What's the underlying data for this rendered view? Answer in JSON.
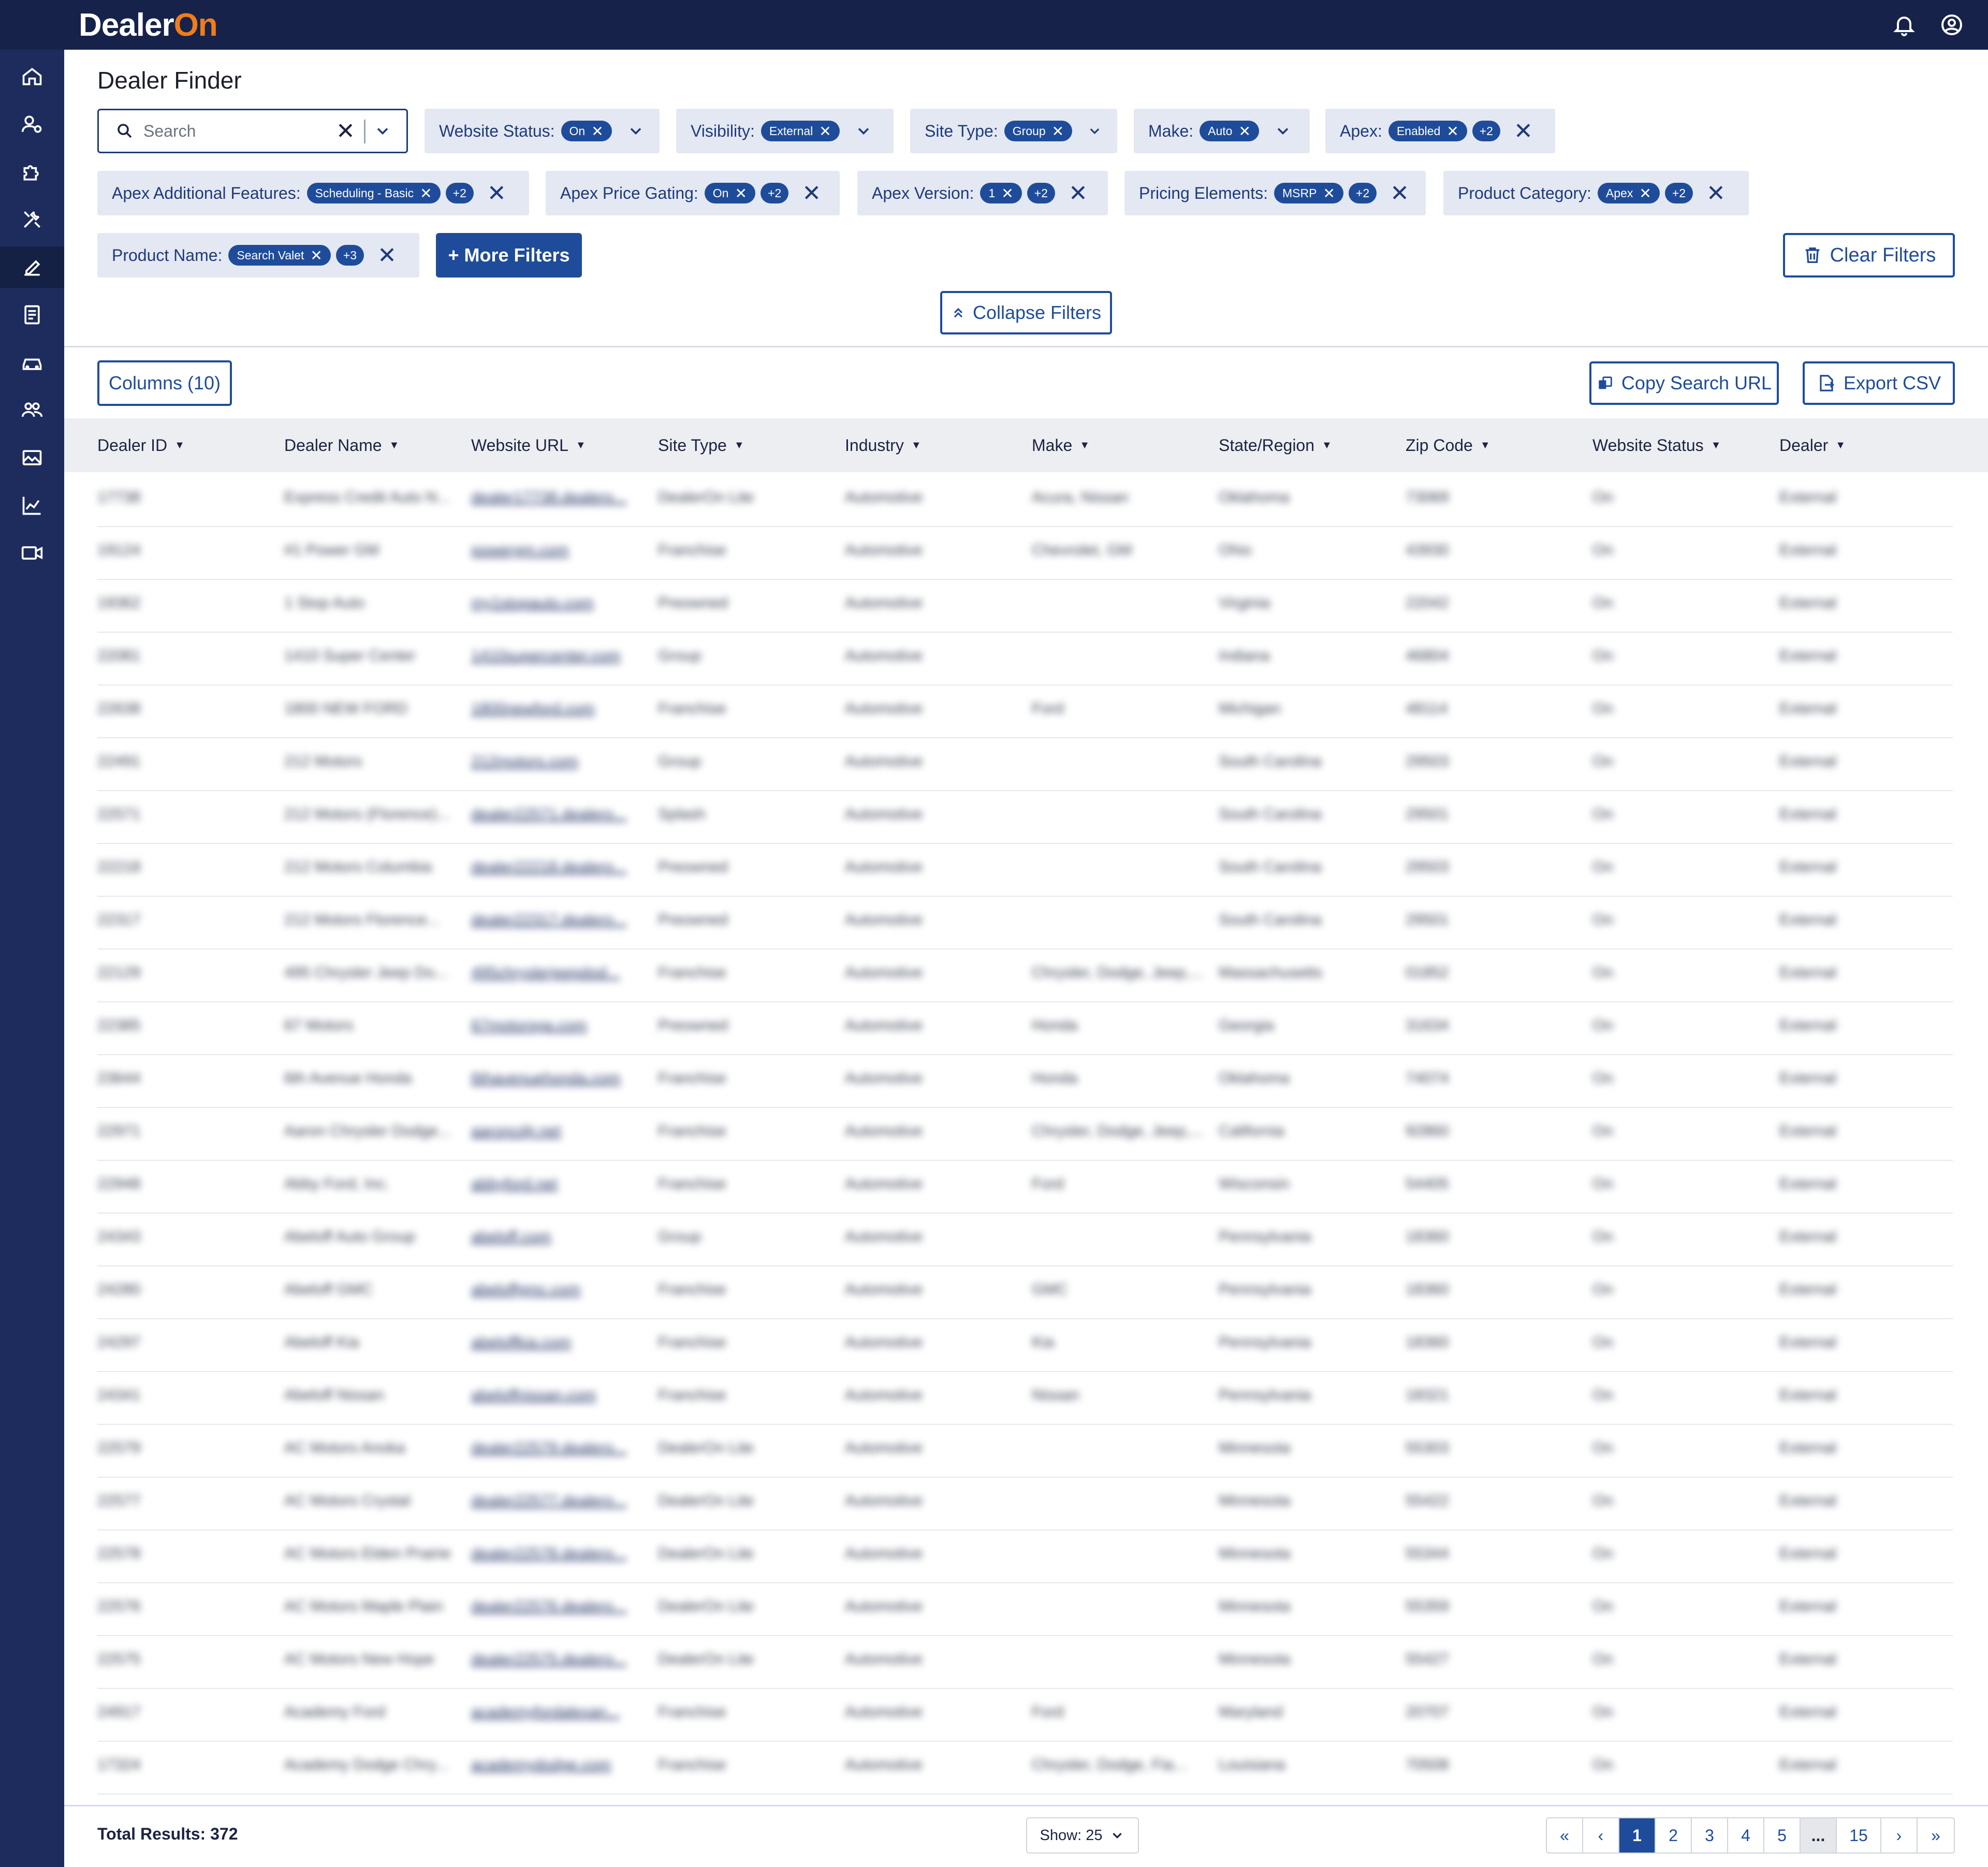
{
  "app": {
    "logo_left": "Dealer",
    "logo_right": "On"
  },
  "page": {
    "title": "Dealer Finder"
  },
  "search": {
    "placeholder": "Search"
  },
  "filters": [
    {
      "label": "Website Status:",
      "value": "On"
    },
    {
      "label": "Visibility:",
      "value": "External"
    },
    {
      "label": "Site Type:",
      "value": "Group"
    },
    {
      "label": "Make:",
      "value": "Auto"
    },
    {
      "label": "Apex:",
      "value": "Enabled",
      "more": "+2"
    },
    {
      "label": "Apex Additional Features:",
      "value": "Scheduling - Basic",
      "more": "+2"
    },
    {
      "label": "Apex Price Gating:",
      "value": "On",
      "more": "+2"
    },
    {
      "label": "Apex Version:",
      "value": "1",
      "more": "+2"
    },
    {
      "label": "Pricing Elements:",
      "value": "MSRP",
      "more": "+2"
    },
    {
      "label": "Product Category:",
      "value": "Apex",
      "more": "+2"
    },
    {
      "label": "Product Name:",
      "value": "Search Valet",
      "more": "+3"
    }
  ],
  "buttons": {
    "more_filters": "+ More Filters",
    "clear_filters": "Clear Filters",
    "collapse_filters": "Collapse Filters",
    "columns": "Columns (10)",
    "copy_search_url": "Copy Search URL",
    "export_csv": "Export CSV"
  },
  "table": {
    "columns": [
      "Dealer ID",
      "Dealer Name",
      "Website URL",
      "Site Type",
      "Industry",
      "Make",
      "State/Region",
      "Zip Code",
      "Website Status",
      "Dealer"
    ],
    "rows": [
      [
        "17738",
        "Express Credit Auto N...",
        "dealer17738.dealero...",
        "DealerOn Lite",
        "Automotive",
        "Acura, Nissan",
        "Oklahoma",
        "73069",
        "On",
        "External"
      ],
      [
        "19124",
        "#1 Power GM",
        "powergm.com",
        "Franchise",
        "Automotive",
        "Chevrolet, GM",
        "Ohio",
        "43930",
        "On",
        "External"
      ],
      [
        "19362",
        "1 Stop Auto",
        "my1stopauto.com",
        "Preowned",
        "Automotive",
        "",
        "Virginia",
        "22042",
        "On",
        "External"
      ],
      [
        "22081",
        "1410 Super Center",
        "1410supercenter.com",
        "Group",
        "Automotive",
        "",
        "Indiana",
        "46804",
        "On",
        "External"
      ],
      [
        "22638",
        "1800 NEW FORD",
        "1800newford.com",
        "Franchise",
        "Automotive",
        "Ford",
        "Michigan",
        "48114",
        "On",
        "External"
      ],
      [
        "22491",
        "212 Motors",
        "212motors.com",
        "Group",
        "Automotive",
        "",
        "South Carolina",
        "29503",
        "On",
        "External"
      ],
      [
        "22571",
        "212 Motors (Florence)...",
        "dealer22571.dealero...",
        "Splash",
        "Automotive",
        "",
        "South Carolina",
        "29501",
        "On",
        "External"
      ],
      [
        "22218",
        "212 Motors Columbia",
        "dealer22218.dealero...",
        "Preowned",
        "Automotive",
        "",
        "South Carolina",
        "29503",
        "On",
        "External"
      ],
      [
        "22317",
        "212 Motors Florence...",
        "dealer22317.dealero...",
        "Preowned",
        "Automotive",
        "",
        "South Carolina",
        "29501",
        "On",
        "External"
      ],
      [
        "22129",
        "495 Chrysler Jeep Do...",
        "495chryslerjeepdod...",
        "Franchise",
        "Automotive",
        "Chrysler, Dodge, Jeep,...",
        "Massachusetts",
        "01852",
        "On",
        "External"
      ],
      [
        "22385",
        "67 Motors",
        "67motorsga.com",
        "Preowned",
        "Automotive",
        "Honda",
        "Georgia",
        "31634",
        "On",
        "External"
      ],
      [
        "23644",
        "6th Avenue Honda",
        "6thavenuehonda.com",
        "Franchise",
        "Automotive",
        "Honda",
        "Oklahoma",
        "74074",
        "On",
        "External"
      ],
      [
        "22971",
        "Aaron Chrysler Dodge...",
        "aaroncdjr.net",
        "Franchise",
        "Automotive",
        "Chrysler, Dodge, Jeep,...",
        "California",
        "92860",
        "On",
        "External"
      ],
      [
        "22948",
        "Abby Ford, Inc.",
        "abbyford.net",
        "Franchise",
        "Automotive",
        "Ford",
        "Wisconsin",
        "54405",
        "On",
        "External"
      ],
      [
        "24343",
        "Abeloff Auto Group",
        "abeloff.com",
        "Group",
        "Automotive",
        "",
        "Pennsylvania",
        "18360",
        "On",
        "External"
      ],
      [
        "24280",
        "Abeloff GMC",
        "abeloffgmc.com",
        "Franchise",
        "Automotive",
        "GMC",
        "Pennsylvania",
        "18360",
        "On",
        "External"
      ],
      [
        "24297",
        "Abeloff Kia",
        "abeloffkia.com",
        "Franchise",
        "Automotive",
        "Kia",
        "Pennsylvania",
        "18360",
        "On",
        "External"
      ],
      [
        "24341",
        "Abeloff Nissan",
        "abeloffnissan.com",
        "Franchise",
        "Automotive",
        "Nissan",
        "Pennsylvania",
        "18321",
        "On",
        "External"
      ],
      [
        "22579",
        "AC Motors Anoka",
        "dealer22579.dealero...",
        "DealerOn Lite",
        "Automotive",
        "",
        "Minnesota",
        "55303",
        "On",
        "External"
      ],
      [
        "22577",
        "AC Motors Crystal",
        "dealer22577.dealero...",
        "DealerOn Lite",
        "Automotive",
        "",
        "Minnesota",
        "55422",
        "On",
        "External"
      ],
      [
        "22578",
        "AC Motors Elden Prairie",
        "dealer22578.dealero...",
        "DealerOn Lite",
        "Automotive",
        "",
        "Minnesota",
        "55344",
        "On",
        "External"
      ],
      [
        "22576",
        "AC Motors Maple Plain",
        "dealer22576.dealero...",
        "DealerOn Lite",
        "Automotive",
        "",
        "Minnesota",
        "55359",
        "On",
        "External"
      ],
      [
        "22575",
        "AC Motors New Hope",
        "dealer22575.dealero...",
        "DealerOn Lite",
        "Automotive",
        "",
        "Minnesota",
        "55427",
        "On",
        "External"
      ],
      [
        "24917",
        "Academy Ford",
        "academyfordalexan...",
        "Franchise",
        "Automotive",
        "Ford",
        "Maryland",
        "20707",
        "On",
        "External"
      ],
      [
        "17324",
        "Academy Dodge Chry...",
        "academydodge.com",
        "Franchise",
        "Automotive",
        "Chrysler, Dodge, Fia...",
        "Louisiana",
        "70508",
        "On",
        "External"
      ]
    ]
  },
  "footer": {
    "total_results": "Total Results: 372",
    "show": "Show: 25",
    "pages": [
      "1",
      "2",
      "3",
      "4",
      "5",
      "...",
      "15"
    ]
  }
}
